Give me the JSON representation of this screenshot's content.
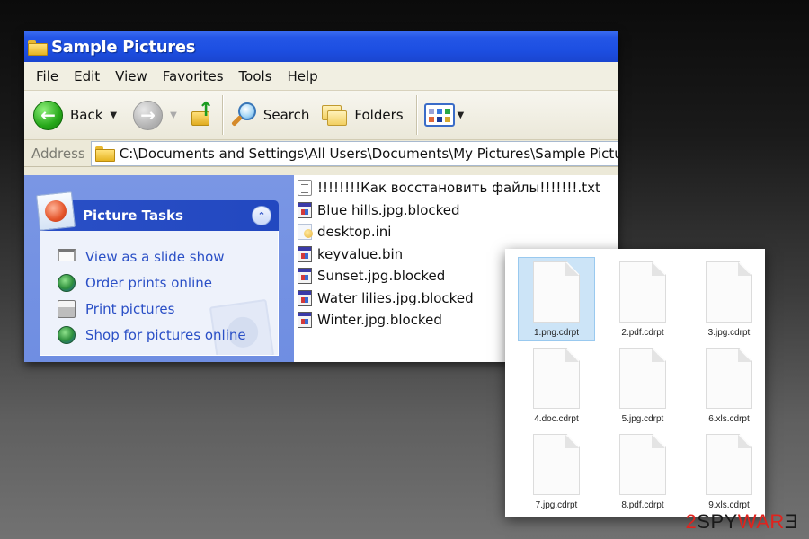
{
  "xp_window": {
    "title": "Sample Pictures",
    "menu": [
      "File",
      "Edit",
      "View",
      "Favorites",
      "Tools",
      "Help"
    ],
    "toolbar": {
      "back_label": "Back",
      "search_label": "Search",
      "folders_label": "Folders"
    },
    "address": {
      "label": "Address",
      "value": "C:\\Documents and Settings\\All Users\\Documents\\My Pictures\\Sample Pictures"
    },
    "task_panel": {
      "title": "Picture Tasks",
      "items": [
        {
          "label": "View as a slide show",
          "icon": "slideshow-icon"
        },
        {
          "label": "Order prints online",
          "icon": "globe-icon"
        },
        {
          "label": "Print pictures",
          "icon": "printer-icon"
        },
        {
          "label": "Shop for pictures online",
          "icon": "globe-icon"
        }
      ]
    },
    "files": [
      {
        "name": "!!!!!!!!Как восстановить файлы!!!!!!!.txt",
        "icon": "text-file-icon"
      },
      {
        "name": "Blue hills.jpg.blocked",
        "icon": "blocked-file-icon"
      },
      {
        "name": "desktop.ini",
        "icon": "ini-file-icon"
      },
      {
        "name": "keyvalue.bin",
        "icon": "blocked-file-icon"
      },
      {
        "name": "Sunset.jpg.blocked",
        "icon": "blocked-file-icon"
      },
      {
        "name": "Water lilies.jpg.blocked",
        "icon": "blocked-file-icon"
      },
      {
        "name": "Winter.jpg.blocked",
        "icon": "blocked-file-icon"
      }
    ]
  },
  "modern_window": {
    "files": [
      {
        "name": "1.png.cdrpt",
        "selected": true
      },
      {
        "name": "2.pdf.cdrpt",
        "selected": false
      },
      {
        "name": "3.jpg.cdrpt",
        "selected": false
      },
      {
        "name": "4.doc.cdrpt",
        "selected": false
      },
      {
        "name": "5.jpg.cdrpt",
        "selected": false
      },
      {
        "name": "6.xls.cdrpt",
        "selected": false
      },
      {
        "name": "7.jpg.cdrpt",
        "selected": false
      },
      {
        "name": "8.pdf.cdrpt",
        "selected": false
      },
      {
        "name": "9.xls.cdrpt",
        "selected": false
      }
    ]
  },
  "watermark": {
    "part1": "2",
    "part2": "SPY",
    "part3": "WAR",
    "part4": "Ǝ"
  },
  "colors": {
    "xp_title_blue": "#1d4fe2",
    "task_link_blue": "#2a4fc6",
    "selection_blue": "#cce4f7",
    "watermark_red": "#e0231d"
  }
}
